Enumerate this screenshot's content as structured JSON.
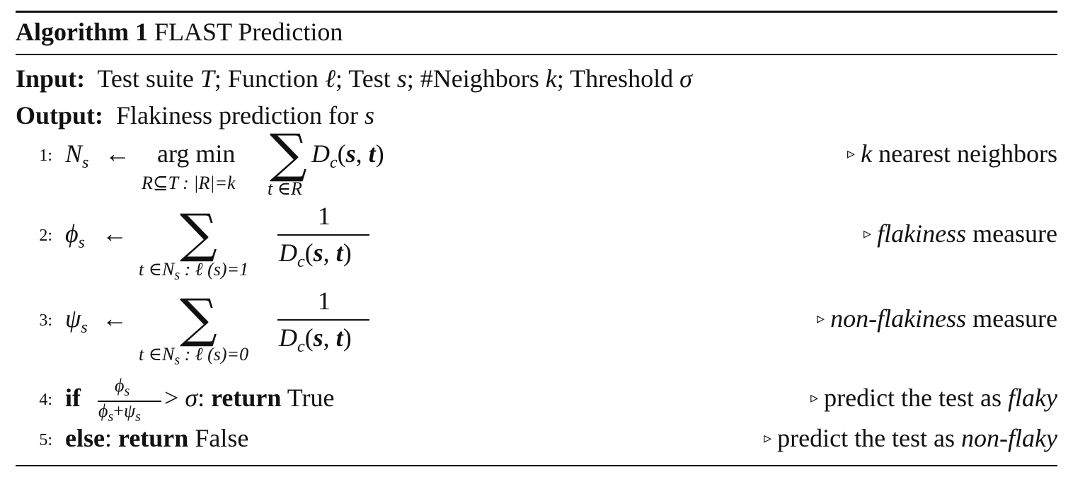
{
  "algorithm": {
    "label": "Algorithm 1",
    "name": "FLAST Prediction"
  },
  "input": {
    "label": "Input:",
    "p1": "Test suite ",
    "T": "T",
    "p2": "; Function ",
    "ell": "ℓ",
    "p3": "; Test ",
    "s": "s",
    "p4": "; #Neighbors ",
    "k": "k",
    "p5": "; Threshold ",
    "sigma": "σ"
  },
  "output": {
    "label": "Output:",
    "text": "Flakiness prediction for ",
    "s": "s"
  },
  "lines": {
    "l1": {
      "num": "1:",
      "N": "N",
      "N_sub": "s",
      "arrow": "←",
      "argmin": "arg min",
      "argmin_sub": "R⊆T : |R|=k",
      "sum": "∑",
      "sum_sub": "t ∈R",
      "D": "D",
      "D_sub": "c",
      "paren_open": "(",
      "s": "s",
      "comma": ", ",
      "t": "t",
      "paren_close": ")",
      "comment_k": "k",
      "comment_rest": " nearest neighbors"
    },
    "l2": {
      "num": "2:",
      "phi": "ϕ",
      "phi_sub": "s",
      "arrow": "←",
      "sum": "∑",
      "sum_sub_a": "t ∈N",
      "sum_sub_s": "s",
      "sum_sub_b": " : ℓ (s)=1",
      "numer": "1",
      "D": "D",
      "D_sub": "c",
      "paren_open": "(",
      "s": "s",
      "comma": ", ",
      "t": "t",
      "paren_close": ")",
      "comment_it": "flakiness",
      "comment_rest": " measure"
    },
    "l3": {
      "num": "3:",
      "psi": "ψ",
      "psi_sub": "s",
      "arrow": "←",
      "sum": "∑",
      "sum_sub_a": "t ∈N",
      "sum_sub_s": "s",
      "sum_sub_b": " : ℓ (s)=0",
      "numer": "1",
      "D": "D",
      "D_sub": "c",
      "paren_open": "(",
      "s": "s",
      "comma": ", ",
      "t": "t",
      "paren_close": ")",
      "comment_it": "non-flakiness",
      "comment_rest": " measure"
    },
    "l4": {
      "num": "4:",
      "kw_if": "if",
      "frac_num_phi": "ϕ",
      "frac_num_sub": "s",
      "frac_den_phi": "ϕ",
      "frac_den_sub1": "s",
      "frac_den_plus": "+",
      "frac_den_psi": "ψ",
      "frac_den_sub2": "s",
      "gt": " > ",
      "sigma": "σ",
      "colon": ": ",
      "kw_return": "return",
      "value": " True",
      "comment_rest": "predict the test as ",
      "comment_it": "flaky"
    },
    "l5": {
      "num": "5:",
      "kw_else": "else",
      "colon": ": ",
      "kw_return": "return",
      "value": " False",
      "comment_rest": "predict the test as ",
      "comment_it": "non-flaky"
    },
    "triangle": "▹"
  }
}
